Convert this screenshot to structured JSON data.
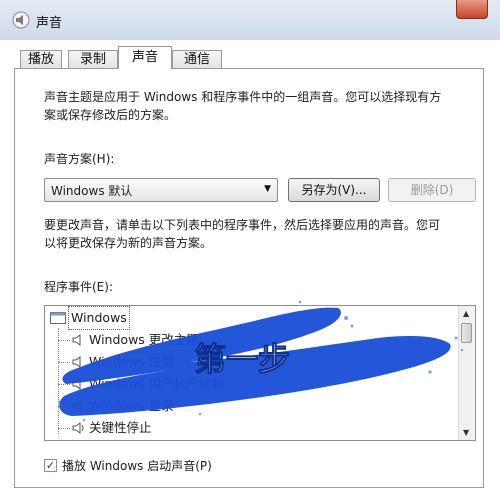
{
  "window": {
    "title": "声音"
  },
  "tabs": [
    {
      "label": "播放"
    },
    {
      "label": "录制"
    },
    {
      "label": "声音"
    },
    {
      "label": "通信"
    }
  ],
  "description": {
    "line1": "声音主题是应用于 Windows 和程序事件中的一组声音。您可以选择现有方",
    "line2": "案或保存修改后的方案。"
  },
  "scheme": {
    "label": "声音方案(H):",
    "value": "Windows 默认",
    "save_as": "另存为(V)...",
    "delete": "删除(D)"
  },
  "instructions": {
    "line1": "要更改声音，请单击以下列表中的程序事件，然后选择要应用的声音。您可",
    "line2": "以将更改保存为新的声音方案。"
  },
  "events": {
    "label": "程序事件(E):",
    "items": [
      {
        "label": "Windows"
      },
      {
        "label": "Windows 更改主题"
      },
      {
        "label": "Windows 注销"
      },
      {
        "label": "Windows 用户帐户控制"
      },
      {
        "label": "Windows 登录"
      },
      {
        "label": "关键性停止"
      }
    ]
  },
  "startup_sound": {
    "label": "播放 Windows 启动声音(P)",
    "checked": true
  },
  "annotation": {
    "text": "第一步",
    "color": "#1a4fd6"
  }
}
